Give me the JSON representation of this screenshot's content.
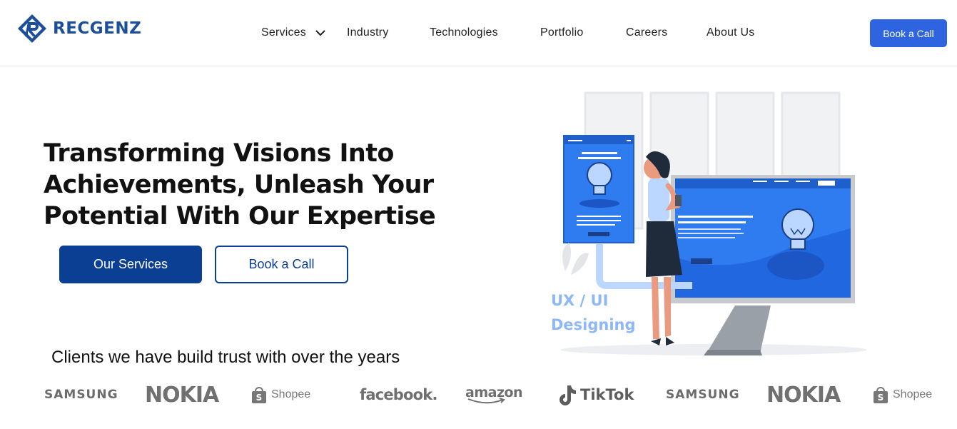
{
  "brand": {
    "name": "RECGENZ",
    "color": "#1b4f9c"
  },
  "nav": {
    "items": [
      {
        "label": "Services"
      },
      {
        "label": "Industry"
      },
      {
        "label": "Technologies"
      },
      {
        "label": "Portfolio"
      },
      {
        "label": "Careers"
      },
      {
        "label": "About Us"
      }
    ],
    "cta": "Book a Call"
  },
  "hero": {
    "headline_line1": "Transforming Visions Into",
    "headline_line2": "Achievements, Unleash Your",
    "headline_line3": "Potential With Our Expertise",
    "primary_button": "Our Services",
    "secondary_button": "Book a Call",
    "illustration_caption_line1": "UX / UI",
    "illustration_caption_line2": "Designing"
  },
  "clients": {
    "title": "Clients we have build trust with over the years",
    "logos": [
      "SAMSUNG",
      "NOKIA",
      "Shopee",
      "facebook.",
      "amazon",
      "TikTok",
      "SAMSUNG",
      "NOKIA",
      "Shopee"
    ]
  },
  "colors": {
    "primary_dark": "#0b3f94",
    "accent_blue": "#2e64e0",
    "illustration_blue": "#2f7cf0"
  }
}
